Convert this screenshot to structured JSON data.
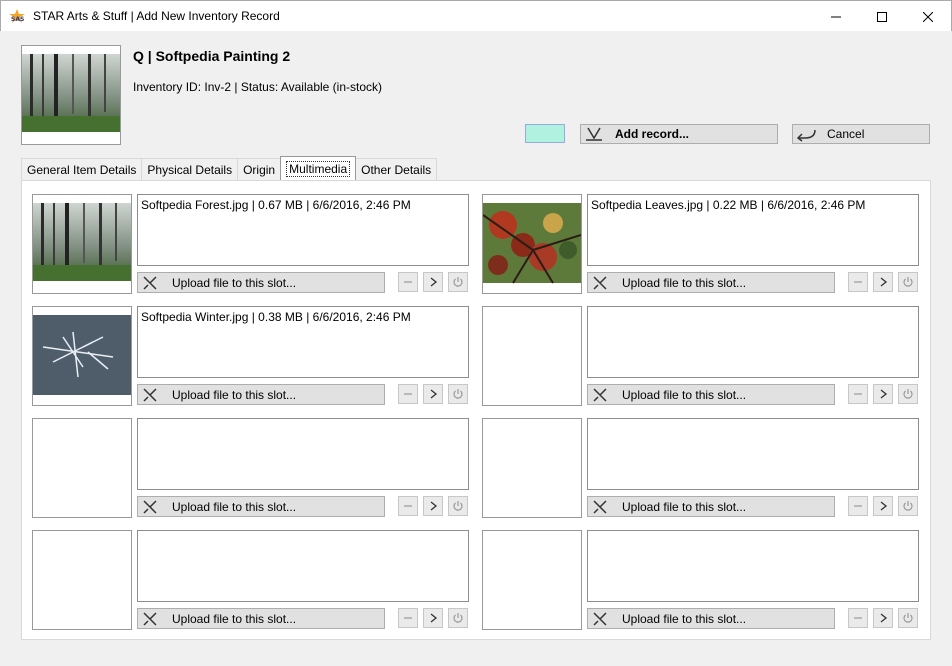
{
  "window": {
    "title": "STAR Arts & Stuff | Add New Inventory Record"
  },
  "header": {
    "item_title": "Q | Softpedia Painting 2",
    "item_subtitle": "Inventory ID: Inv-2 | Status: Available (in-stock)",
    "swatch_color": "#b0f2e0",
    "add_label": "Add record...",
    "cancel_label": "Cancel"
  },
  "tabs": [
    {
      "label": "General Item Details",
      "active": false
    },
    {
      "label": "Physical Details",
      "active": false
    },
    {
      "label": "Origin",
      "active": false
    },
    {
      "label": "Multimedia",
      "active": true
    },
    {
      "label": "Other Details",
      "active": false
    }
  ],
  "slots": [
    {
      "info": "Softpedia Forest.jpg | 0.67 MB | 6/6/2016, 2:46 PM",
      "thumb": "forest",
      "upload_label": "Upload file to this slot..."
    },
    {
      "info": "Softpedia Leaves.jpg | 0.22 MB | 6/6/2016, 2:46 PM",
      "thumb": "leaves",
      "upload_label": "Upload file to this slot..."
    },
    {
      "info": "Softpedia Winter.jpg | 0.38 MB | 6/6/2016, 2:46 PM",
      "thumb": "winter",
      "upload_label": "Upload file to this slot..."
    },
    {
      "info": "",
      "thumb": "",
      "upload_label": "Upload file to this slot..."
    },
    {
      "info": "",
      "thumb": "",
      "upload_label": "Upload file to this slot..."
    },
    {
      "info": "",
      "thumb": "",
      "upload_label": "Upload file to this slot..."
    },
    {
      "info": "",
      "thumb": "",
      "upload_label": "Upload file to this slot..."
    },
    {
      "info": "",
      "thumb": "",
      "upload_label": "Upload file to this slot..."
    }
  ]
}
